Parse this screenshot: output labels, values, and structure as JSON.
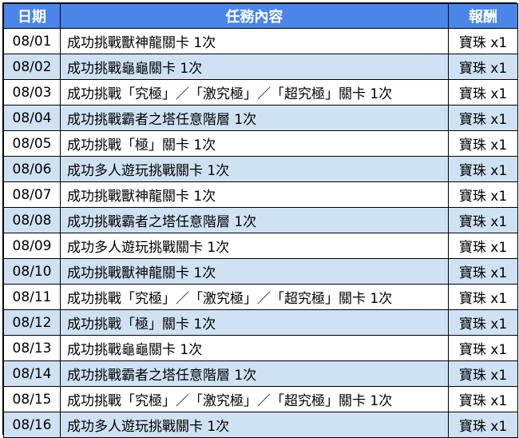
{
  "colors": {
    "header_bg": "#4a86e8",
    "header_text": "#ffffff",
    "row_alt_bg": "#cfe2f3",
    "row_bg": "#ffffff",
    "border": "#000000"
  },
  "table": {
    "headers": [
      "日期",
      "任務內容",
      "報酬"
    ],
    "rows": [
      {
        "date": "08/01",
        "task": "成功挑戰獸神龍關卡 1次",
        "reward": "寶珠 x1"
      },
      {
        "date": "08/02",
        "task": "成功挑戰龜龜關卡 1次",
        "reward": "寶珠 x1"
      },
      {
        "date": "08/03",
        "task": "成功挑戰「究極」／「激究極」／「超究極」關卡 1次",
        "reward": "寶珠 x1"
      },
      {
        "date": "08/04",
        "task": "成功挑戰霸者之塔任意階層 1次",
        "reward": "寶珠 x1"
      },
      {
        "date": "08/05",
        "task": "成功挑戰「極」關卡 1次",
        "reward": "寶珠 x1"
      },
      {
        "date": "08/06",
        "task": "成功多人遊玩挑戰關卡 1次",
        "reward": "寶珠 x1"
      },
      {
        "date": "08/07",
        "task": "成功挑戰獸神龍關卡 1次",
        "reward": "寶珠 x1"
      },
      {
        "date": "08/08",
        "task": "成功挑戰霸者之塔任意階層 1次",
        "reward": "寶珠 x1"
      },
      {
        "date": "08/09",
        "task": "成功多人遊玩挑戰關卡 1次",
        "reward": "寶珠 x1"
      },
      {
        "date": "08/10",
        "task": "成功挑戰獸神龍關卡 1次",
        "reward": "寶珠 x1"
      },
      {
        "date": "08/11",
        "task": "成功挑戰「究極」／「激究極」／「超究極」關卡 1次",
        "reward": "寶珠 x1"
      },
      {
        "date": "08/12",
        "task": "成功挑戰「極」關卡 1次",
        "reward": "寶珠 x1"
      },
      {
        "date": "08/13",
        "task": "成功挑戰龜龜關卡 1次",
        "reward": "寶珠 x1"
      },
      {
        "date": "08/14",
        "task": "成功挑戰霸者之塔任意階層 1次",
        "reward": "寶珠 x1"
      },
      {
        "date": "08/15",
        "task": "成功挑戰「究極」／「激究極」／「超究極」關卡 1次",
        "reward": "寶珠 x1"
      },
      {
        "date": "08/16",
        "task": "成功多人遊玩挑戰關卡 1次",
        "reward": "寶珠 x1"
      }
    ]
  }
}
